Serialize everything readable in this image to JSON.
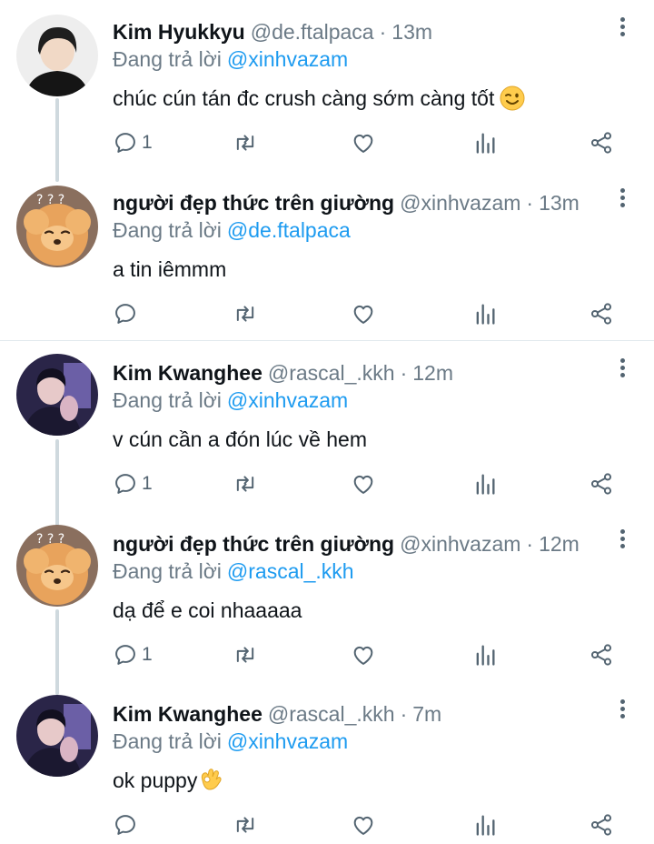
{
  "replying_label": "Đang trả lời",
  "tweets": [
    {
      "name": "Kim Hyukkyu",
      "handle": "@de.ftalpaca",
      "time": "13m",
      "reply_to": "@xinhvazam",
      "text": "chúc cún tán đc crush càng sớm càng tốt",
      "emoji": "winking-face",
      "reply_count": "1",
      "avatar": "person-dark-hair-avatar"
    },
    {
      "name": "người đẹp thức trên giường",
      "handle": "@xinhvazam",
      "time": "13m",
      "reply_to": "@de.ftalpaca",
      "text": "a tin iêmmm",
      "emoji": "",
      "reply_count": "",
      "avatar": "fluffy-dog-avatar"
    },
    {
      "name": "Kim Kwanghee",
      "handle": "@rascal_.kkh",
      "time": "12m",
      "reply_to": "@xinhvazam",
      "text": "v cún cần a đón lúc về hem",
      "emoji": "",
      "reply_count": "1",
      "avatar": "person-purple-avatar"
    },
    {
      "name": "người đẹp thức trên giường",
      "handle": "@xinhvazam",
      "time": "12m",
      "reply_to": "@rascal_.kkh",
      "text": "dạ để e coi nhaaaaa",
      "emoji": "",
      "reply_count": "1",
      "avatar": "fluffy-dog-avatar"
    },
    {
      "name": "Kim Kwanghee",
      "handle": "@rascal_.kkh",
      "time": "7m",
      "reply_to": "@xinhvazam",
      "text": "ok puppy",
      "emoji": "ok-hand",
      "reply_count": "",
      "avatar": "person-purple-avatar"
    }
  ],
  "colors": {
    "mention": "#1d9bf0",
    "meta": "#6b7a86",
    "icon": "#536471",
    "thread_line": "#cfd9de"
  }
}
